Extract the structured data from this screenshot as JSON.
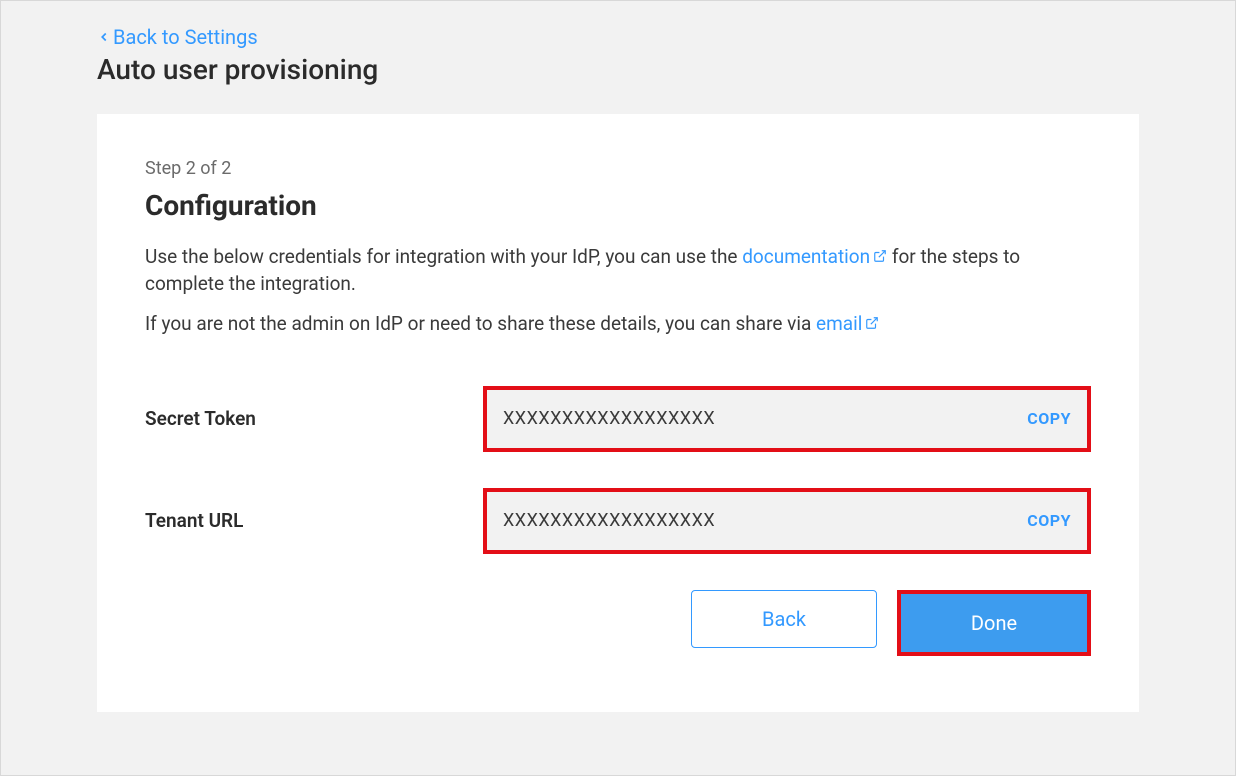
{
  "nav": {
    "back_label": "Back to Settings"
  },
  "page": {
    "title": "Auto user provisioning"
  },
  "card": {
    "step_label": "Step 2 of 2",
    "title": "Configuration",
    "desc1_part1": "Use the below credentials for integration with your IdP, you can use the ",
    "desc1_link": "documentation",
    "desc1_part2": " for the steps to complete the integration.",
    "desc2_part1": "If you are not the admin on IdP or need to share these details, you can share via ",
    "desc2_link": "email"
  },
  "fields": {
    "secret_token": {
      "label": "Secret Token",
      "value": "XXXXXXXXXXXXXXXXXX",
      "copy": "COPY"
    },
    "tenant_url": {
      "label": "Tenant URL",
      "value": "XXXXXXXXXXXXXXXXXX",
      "copy": "COPY"
    }
  },
  "actions": {
    "back": "Back",
    "done": "Done"
  }
}
